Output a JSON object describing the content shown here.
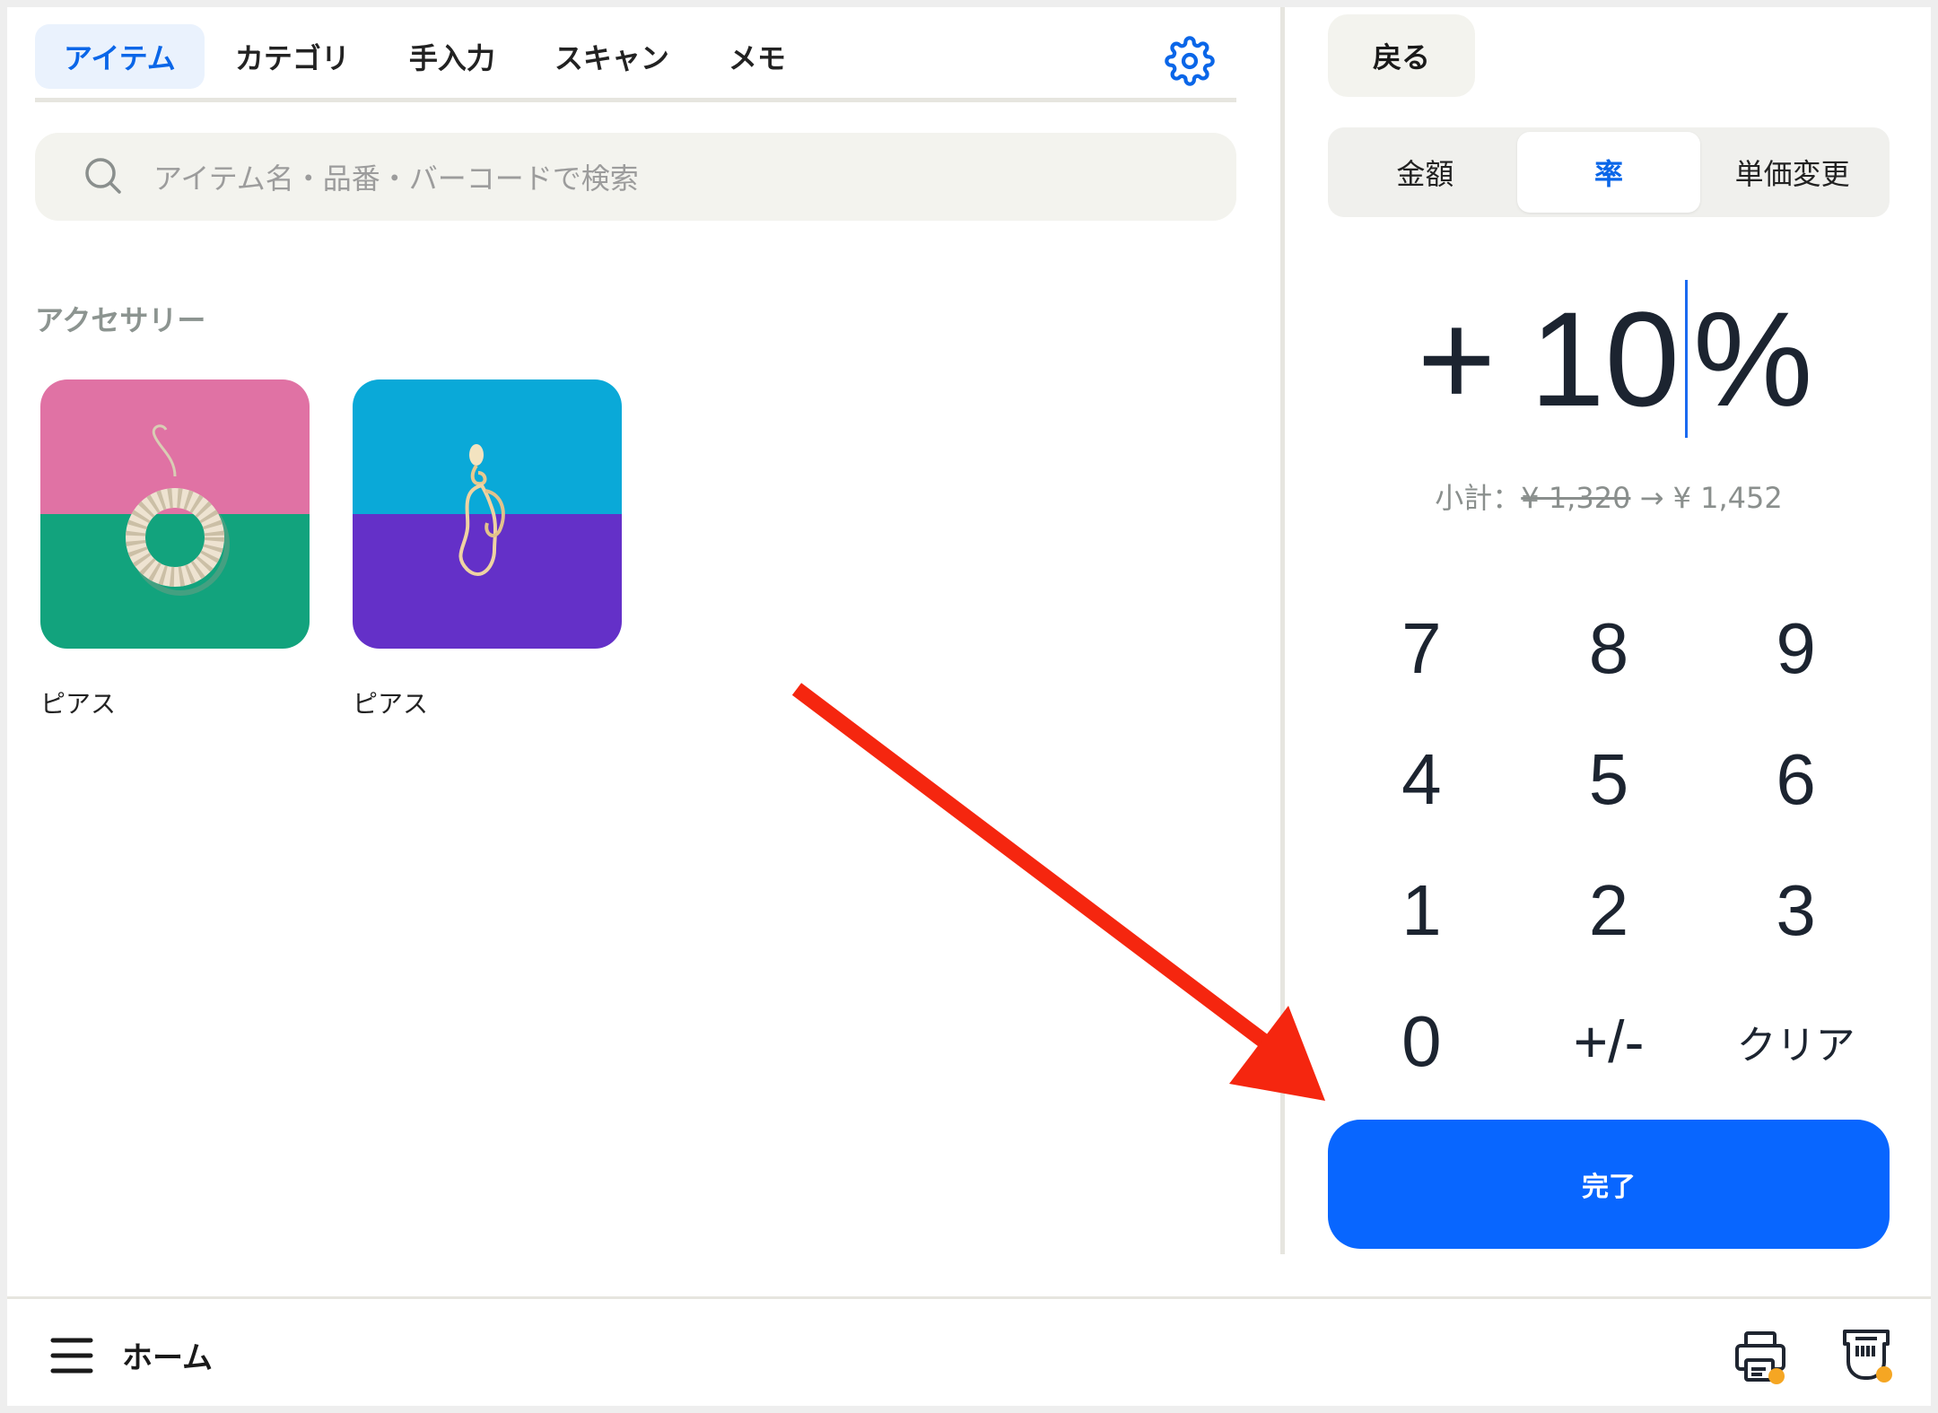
{
  "tabs": [
    {
      "label": "アイテム",
      "active": true
    },
    {
      "label": "カテゴリ",
      "active": false
    },
    {
      "label": "手入力",
      "active": false
    },
    {
      "label": "スキャン",
      "active": false
    },
    {
      "label": "メモ",
      "active": false
    }
  ],
  "search": {
    "placeholder": "アイテム名・品番・バーコードで検索"
  },
  "section": {
    "title": "アクセサリー"
  },
  "items": [
    {
      "label": "ピアス",
      "colors": {
        "top": "#e072a4",
        "bottom": "#12a37d"
      }
    },
    {
      "label": "ピアス",
      "colors": {
        "top": "#0aa9d8",
        "bottom": "#6430c8"
      }
    }
  ],
  "panel": {
    "back_label": "戻る",
    "segments": [
      {
        "label": "金額",
        "active": false
      },
      {
        "label": "率",
        "active": true
      },
      {
        "label": "単価変更",
        "active": false
      }
    ],
    "value": {
      "sign": "+",
      "number": "10",
      "unit": "%"
    },
    "subtotal": {
      "label": "小計：",
      "old": "¥ 1,320",
      "arrow": "→",
      "new": "¥ 1,452"
    },
    "keys": [
      "7",
      "8",
      "9",
      "4",
      "5",
      "6",
      "1",
      "2",
      "3",
      "0",
      "+/-",
      "クリア"
    ],
    "done_label": "完了"
  },
  "bottom_bar": {
    "home_label": "ホーム"
  },
  "colors": {
    "accent": "#0866ff",
    "active_tab_bg": "#eaf2fd",
    "annotation_arrow": "#f5260f",
    "status_dot": "#f5a623"
  },
  "icons": [
    "gear-icon",
    "search-icon",
    "menu-icon",
    "printer-icon",
    "card-reader-icon"
  ]
}
